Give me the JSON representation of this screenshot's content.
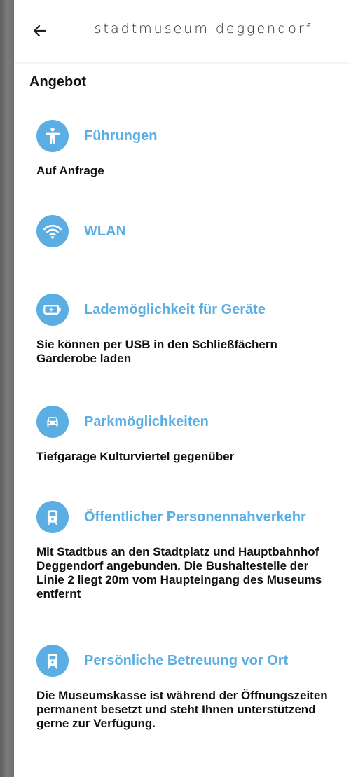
{
  "header": {
    "title": "Stadtmuseum Deggendorf",
    "back_icon": "arrow-left-icon"
  },
  "page": {
    "title": "Angebot"
  },
  "accent_color": "#5aaee3",
  "items": [
    {
      "icon": "accessibility-person-icon",
      "title": "Führungen",
      "description": "Auf Anfrage"
    },
    {
      "icon": "wifi-icon",
      "title": "WLAN",
      "description": ""
    },
    {
      "icon": "battery-charging-icon",
      "title": "Lademöglichkeit für Geräte",
      "description": "Sie können per USB in den Schließfächern Garderobe laden"
    },
    {
      "icon": "car-icon",
      "title": "Parkmöglichkeiten",
      "description": "Tiefgarage Kulturviertel gegenüber"
    },
    {
      "icon": "train-icon",
      "title": "Öffentlicher Personennahverkehr",
      "description": "Mit Stadtbus an den Stadtplatz und Hauptbahnhof Deggendorf angebunden. Die Bushaltestelle der Linie 2 liegt 20m vom Haupteingang des Museums entfernt"
    },
    {
      "icon": "train-icon",
      "title": "Persönliche Betreuung vor Ort",
      "description": "Die Museumskasse ist während der Öffnungszeiten permanent besetzt und steht Ihnen unterstützend gerne zur Verfügung."
    }
  ]
}
